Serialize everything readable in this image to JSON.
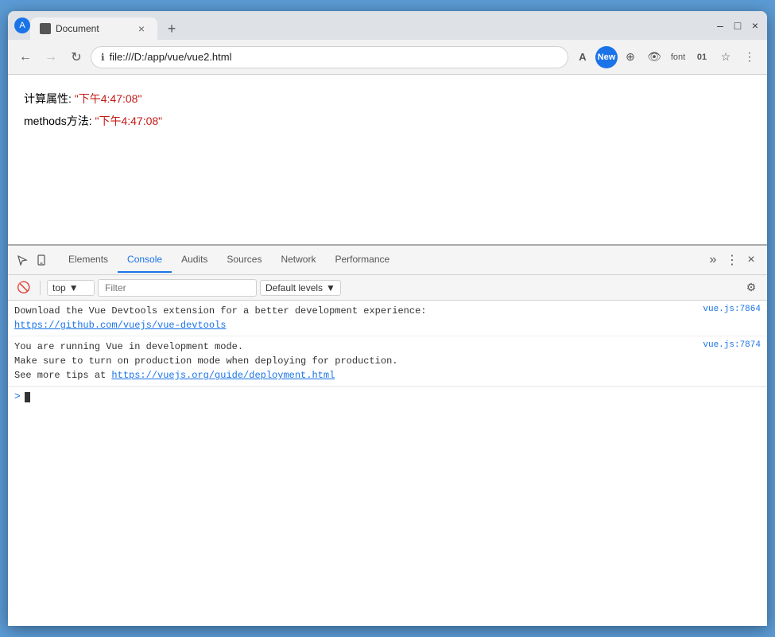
{
  "window": {
    "titlebar": {
      "tab_title": "Document",
      "tab_close_icon": "×",
      "new_tab_icon": "+",
      "profile_letter": "A",
      "minimize_icon": "–",
      "maximize_icon": "□",
      "close_icon": "×"
    },
    "navbar": {
      "back_icon": "←",
      "forward_icon": "→",
      "refresh_icon": "↻",
      "url": "file:///D:/app/vue/vue2.html",
      "lock_icon": "ℹ",
      "star_icon": "☆",
      "translate_icon": "A",
      "extensions_icon": "⊕",
      "menu_icon": "⋮"
    },
    "page": {
      "line1_label": "计算属性: ",
      "line1_value": "\"下午4:47:08\"",
      "line2_label": "methods方法: ",
      "line2_value": "\"下午4:47:08\""
    },
    "devtools": {
      "tabs": [
        {
          "id": "elements",
          "label": "Elements"
        },
        {
          "id": "console",
          "label": "Console"
        },
        {
          "id": "audits",
          "label": "Audits"
        },
        {
          "id": "sources",
          "label": "Sources"
        },
        {
          "id": "network",
          "label": "Network"
        },
        {
          "id": "performance",
          "label": "Performance"
        }
      ],
      "active_tab": "console",
      "more_icon": "»",
      "toolbar": {
        "no_icon": "🚫",
        "context_label": "top",
        "context_arrow": "▼",
        "filter_placeholder": "Filter",
        "levels_label": "Default levels",
        "levels_arrow": "▼",
        "settings_icon": "⚙"
      },
      "console": {
        "messages": [
          {
            "text": "Download the Vue Devtools extension for a better development experience:\nhttps://github.com/vuejs/vue-devtools",
            "link": "https://github.com/vuejs/vue-devtools",
            "source": "vue.js:7864",
            "has_link": true
          },
          {
            "text": "You are running Vue in development mode.\nMake sure to turn on production mode when deploying for production.\nSee more tips at https://vuejs.org/guide/deployment.html",
            "link": "https://vuejs.org/guide/deployment.html",
            "source": "vue.js:7874",
            "has_link": true
          }
        ],
        "prompt": ">",
        "input_text": ""
      }
    }
  }
}
